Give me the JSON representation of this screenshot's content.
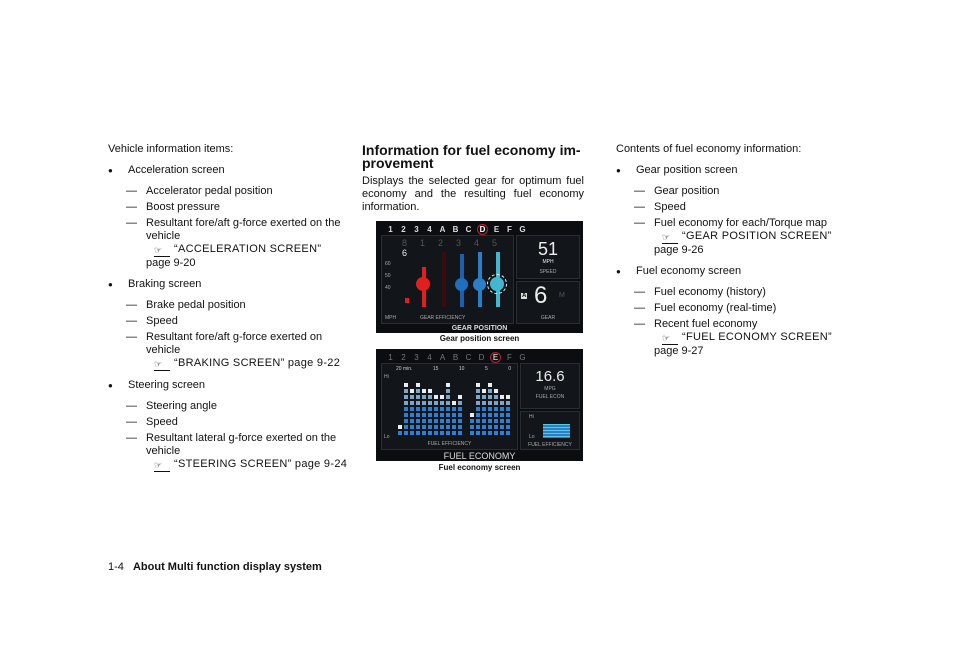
{
  "left": {
    "intro": "Vehicle information items:",
    "items": [
      {
        "title": "Acceleration screen",
        "subs": [
          "Accelerator pedal position",
          "Boost pressure"
        ],
        "last": "Resultant fore/aft g-force exerted on the",
        "last_cont": "vehicle",
        "ref": "“ACCELERATION SCREEN”",
        "page": "page 9-20"
      },
      {
        "title": "Braking screen",
        "subs": [
          "Brake pedal position",
          "Speed"
        ],
        "last": "Resultant fore/aft g-force exerted on",
        "last_cont": "vehicle",
        "ref": "“BRAKING SCREEN” page 9-22",
        "page": ""
      },
      {
        "title": "Steering screen",
        "subs": [
          "Steering angle",
          "Speed"
        ],
        "last": "Resultant lateral g-force exerted on the",
        "last_cont": "vehicle",
        "ref": "“STEERING SCREEN” page 9-24",
        "page": ""
      }
    ]
  },
  "middle": {
    "heading_1": "Information for fuel economy im-",
    "heading_2": "provement",
    "body": "Displays the selected gear for optimum fuel economy and the resulting fuel economy information.",
    "gear_screen": {
      "gears": [
        "1",
        "2",
        "3",
        "4",
        "A",
        "B",
        "C",
        "D",
        "E",
        "F",
        "G"
      ],
      "selected": "D",
      "top_gears": [
        "8",
        "1",
        "2",
        "3",
        "4",
        "5",
        "6"
      ],
      "scale": [
        "60",
        "50",
        "40"
      ],
      "unit": "MPH",
      "efficiency_label": "GEAR EFFICIENCY",
      "speed": "51",
      "speed_unit": "MPH",
      "speed_label": "SPEED",
      "mode": "A",
      "gear": "6",
      "manual": "M",
      "gear_label": "GEAR",
      "title": "GEAR POSITION",
      "caption": "Gear position screen"
    },
    "fuel_screen": {
      "gears": [
        "1",
        "2",
        "3",
        "4",
        "A",
        "B",
        "C",
        "D",
        "E",
        "F",
        "G"
      ],
      "selected": "E",
      "time_ticks": [
        "20 min.",
        "15",
        "10",
        "5",
        "0"
      ],
      "hi": "Hi",
      "lo": "Lo",
      "history_bars": [
        2,
        9,
        8,
        9,
        8,
        8,
        7,
        7,
        9,
        6,
        7,
        0,
        4,
        9,
        8,
        9,
        8,
        7,
        7
      ],
      "efficiency_label": "FUEL EFFICIENCY",
      "value": "16.6",
      "unit": "MPG",
      "value_label": "FUEL ECON",
      "recent_label": "FUEL EFFICIENCY",
      "title": "FUEL ECONOMY",
      "caption": "Fuel economy screen"
    },
    "colors": {
      "red": "#e0201c",
      "blue": "#1e6fc0",
      "cyan": "#3fb8d0",
      "selected_ring": "#c0202a"
    }
  },
  "right": {
    "intro": "Contents of fuel economy information:",
    "items": [
      {
        "title": "Gear position screen",
        "subs": [
          "Gear position",
          "Speed"
        ],
        "last": "Fuel economy for each/Torque map",
        "ref": "“GEAR POSITION SCREEN”",
        "page": "page 9-26"
      },
      {
        "title": "Fuel economy screen",
        "subs": [
          "Fuel economy (history)",
          "Fuel economy (real-time)"
        ],
        "last": "Recent fuel economy",
        "ref": "“FUEL ECONOMY SCREEN”",
        "page": "page 9-27"
      }
    ]
  },
  "footer": {
    "page_number": "1-4",
    "section": "About Multi function display system"
  },
  "glyphs": {
    "bullet": "●",
    "dash": "—",
    "ref_icon": "☞"
  }
}
